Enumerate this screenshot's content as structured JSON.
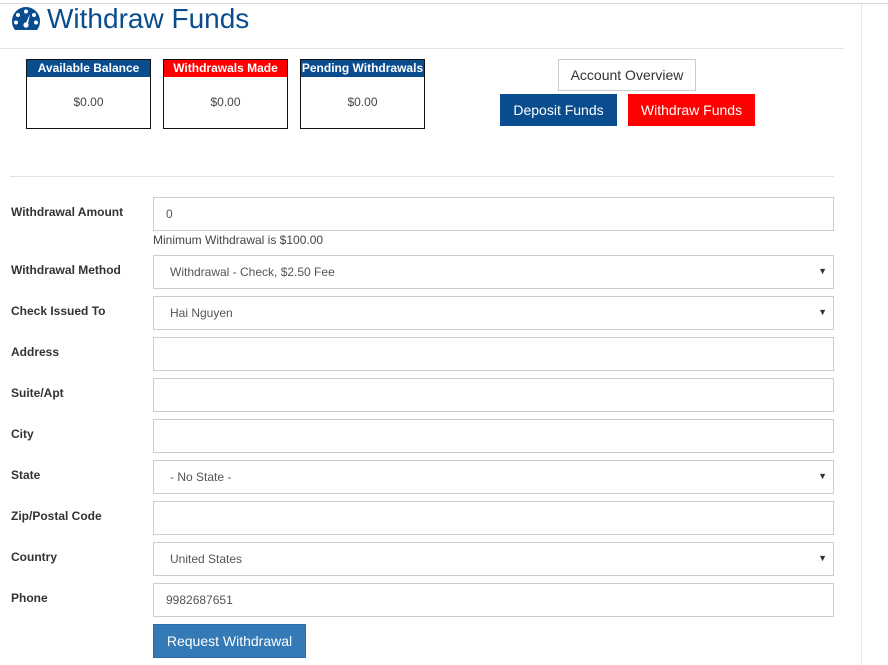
{
  "header": {
    "title": "Withdraw Funds",
    "icon": "dashboard-icon",
    "accent_color": "#0a4d8f"
  },
  "stats": [
    {
      "label": "Available Balance",
      "value": "$0.00",
      "color": "#0a4d8f"
    },
    {
      "label": "Withdrawals Made",
      "value": "$0.00",
      "color": "#ff0000"
    },
    {
      "label": "Pending Withdrawals",
      "value": "$0.00",
      "color": "#0a4d8f"
    }
  ],
  "actions": {
    "account_overview": "Account Overview",
    "deposit_funds": "Deposit Funds",
    "withdraw_funds": "Withdraw Funds"
  },
  "form": {
    "withdrawal_amount": {
      "label": "Withdrawal Amount",
      "value": "0",
      "help": "Minimum Withdrawal is $100.00"
    },
    "withdrawal_method": {
      "label": "Withdrawal Method",
      "value": "Withdrawal - Check, $2.50 Fee"
    },
    "check_issued_to": {
      "label": "Check Issued To",
      "value": "Hai Nguyen"
    },
    "address": {
      "label": "Address",
      "value": ""
    },
    "suite_apt": {
      "label": "Suite/Apt",
      "value": ""
    },
    "city": {
      "label": "City",
      "value": ""
    },
    "state": {
      "label": "State",
      "value": "- No State -"
    },
    "zip": {
      "label": "Zip/Postal Code",
      "value": ""
    },
    "country": {
      "label": "Country",
      "value": "United States"
    },
    "phone": {
      "label": "Phone",
      "value": "9982687651"
    },
    "submit_label": "Request Withdrawal"
  }
}
